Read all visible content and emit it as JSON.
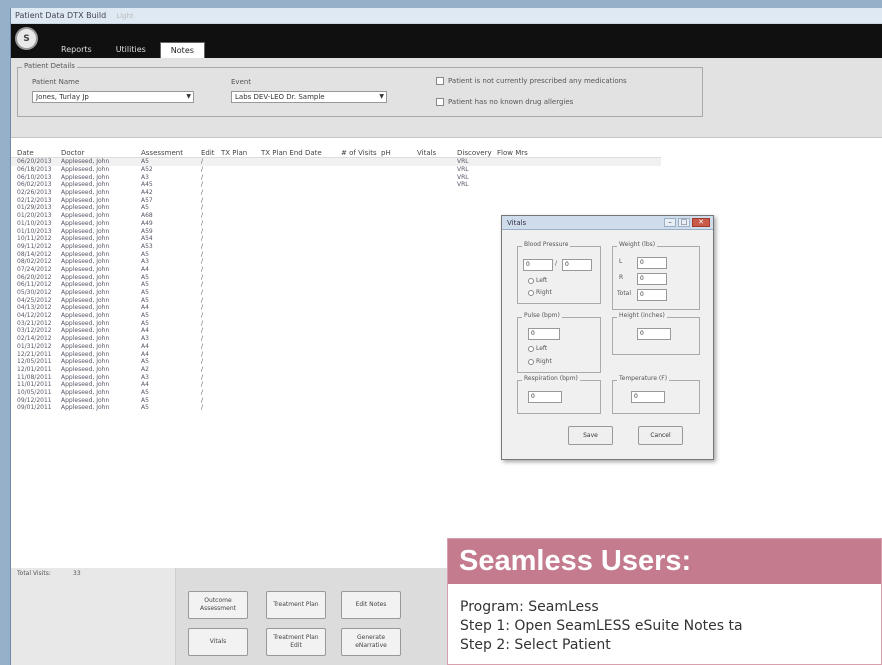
{
  "window": {
    "title": "Patient Data DTX Build",
    "title_tag": "Light"
  },
  "app": {
    "logo_text": "S",
    "tabs": [
      {
        "label": "Reports"
      },
      {
        "label": "Utilities"
      },
      {
        "label": "Notes"
      }
    ],
    "active_tab": 2
  },
  "filters": {
    "group_title": "Patient Details",
    "patient_name_label": "Patient Name",
    "patient_name_value": "Jones, Turlay Jp",
    "event_label": "Event",
    "event_value": "Labs DEV-LEO Dr. Sample",
    "check1_label": "Patient is not currently prescribed any medications",
    "check2_label": "Patient has no known drug allergies"
  },
  "grid": {
    "columns": [
      "Date",
      "Doctor",
      "Assessment",
      "Edit",
      "TX Plan",
      "TX Plan End Date",
      "# of Visits",
      "pH",
      "Vitals",
      "Discovery",
      "Flow Mrs"
    ],
    "rows": [
      {
        "date": "06/20/2013",
        "doctor": "Appleseed, John",
        "assess": "A5",
        "edit": "/",
        "vitals": "VRL"
      },
      {
        "date": "06/18/2013",
        "doctor": "Appleseed, John",
        "assess": "A52",
        "edit": "/",
        "vitals": "VRL"
      },
      {
        "date": "06/10/2013",
        "doctor": "Appleseed, John",
        "assess": "A3",
        "edit": "/",
        "vitals": "VRL"
      },
      {
        "date": "06/02/2013",
        "doctor": "Appleseed, John",
        "assess": "A45",
        "edit": "/",
        "vitals": "VRL"
      },
      {
        "date": "02/26/2013",
        "doctor": "Appleseed, John",
        "assess": "A42",
        "edit": "/",
        "vitals": ""
      },
      {
        "date": "02/12/2013",
        "doctor": "Appleseed, John",
        "assess": "A57",
        "edit": "/",
        "vitals": ""
      },
      {
        "date": "01/29/2013",
        "doctor": "Appleseed, John",
        "assess": "A5",
        "edit": "/",
        "vitals": ""
      },
      {
        "date": "01/20/2013",
        "doctor": "Appleseed, John",
        "assess": "A68",
        "edit": "/",
        "vitals": ""
      },
      {
        "date": "01/10/2013",
        "doctor": "Appleseed, John",
        "assess": "A49",
        "edit": "/",
        "vitals": ""
      },
      {
        "date": "01/10/2013",
        "doctor": "Appleseed, John",
        "assess": "A59",
        "edit": "/",
        "vitals": ""
      },
      {
        "date": "10/11/2012",
        "doctor": "Appleseed, John",
        "assess": "A54",
        "edit": "/",
        "vitals": ""
      },
      {
        "date": "09/11/2012",
        "doctor": "Appleseed, John",
        "assess": "A53",
        "edit": "/",
        "vitals": ""
      },
      {
        "date": "08/14/2012",
        "doctor": "Appleseed, John",
        "assess": "A5",
        "edit": "/",
        "vitals": ""
      },
      {
        "date": "08/02/2012",
        "doctor": "Appleseed, John",
        "assess": "A3",
        "edit": "/",
        "vitals": ""
      },
      {
        "date": "07/24/2012",
        "doctor": "Appleseed, John",
        "assess": "A4",
        "edit": "/",
        "vitals": ""
      },
      {
        "date": "06/20/2012",
        "doctor": "Appleseed, John",
        "assess": "A5",
        "edit": "/",
        "vitals": ""
      },
      {
        "date": "06/11/2012",
        "doctor": "Appleseed, John",
        "assess": "A5",
        "edit": "/",
        "vitals": ""
      },
      {
        "date": "05/30/2012",
        "doctor": "Appleseed, John",
        "assess": "A5",
        "edit": "/",
        "vitals": ""
      },
      {
        "date": "04/25/2012",
        "doctor": "Appleseed, John",
        "assess": "A5",
        "edit": "/",
        "vitals": ""
      },
      {
        "date": "04/13/2012",
        "doctor": "Appleseed, John",
        "assess": "A4",
        "edit": "/",
        "vitals": ""
      },
      {
        "date": "04/12/2012",
        "doctor": "Appleseed, John",
        "assess": "A5",
        "edit": "/",
        "vitals": ""
      },
      {
        "date": "03/21/2012",
        "doctor": "Appleseed, John",
        "assess": "A5",
        "edit": "/",
        "vitals": ""
      },
      {
        "date": "03/12/2012",
        "doctor": "Appleseed, John",
        "assess": "A4",
        "edit": "/",
        "vitals": ""
      },
      {
        "date": "02/14/2012",
        "doctor": "Appleseed, John",
        "assess": "A3",
        "edit": "/",
        "vitals": ""
      },
      {
        "date": "01/31/2012",
        "doctor": "Appleseed, John",
        "assess": "A4",
        "edit": "/",
        "vitals": ""
      },
      {
        "date": "12/21/2011",
        "doctor": "Appleseed, John",
        "assess": "A4",
        "edit": "/",
        "vitals": ""
      },
      {
        "date": "12/05/2011",
        "doctor": "Appleseed, John",
        "assess": "A5",
        "edit": "/",
        "vitals": ""
      },
      {
        "date": "12/01/2011",
        "doctor": "Appleseed, John",
        "assess": "A2",
        "edit": "/",
        "vitals": ""
      },
      {
        "date": "11/08/2011",
        "doctor": "Appleseed, John",
        "assess": "A3",
        "edit": "/",
        "vitals": ""
      },
      {
        "date": "11/01/2011",
        "doctor": "Appleseed, John",
        "assess": "A4",
        "edit": "/",
        "vitals": ""
      },
      {
        "date": "10/05/2011",
        "doctor": "Appleseed, John",
        "assess": "A5",
        "edit": "/",
        "vitals": ""
      },
      {
        "date": "09/12/2011",
        "doctor": "Appleseed, John",
        "assess": "A5",
        "edit": "/",
        "vitals": ""
      },
      {
        "date": "09/01/2011",
        "doctor": "Appleseed, John",
        "assess": "A5",
        "edit": "/",
        "vitals": ""
      }
    ]
  },
  "footer": {
    "total_label": "Total Visits:",
    "total_value": "33",
    "buttons": {
      "outcome": "Outcome Assessment",
      "treatment_plan": "Treatment Plan",
      "edit_notes": "Edit Notes",
      "vitals": "Vitals",
      "treatment_plan_edit": "Treatment Plan Edit",
      "generate_report": "Generate eNarrative"
    }
  },
  "vitals_dialog": {
    "title": "Vitals",
    "blood_pressure": {
      "title": "Blood Pressure",
      "systolic": "0",
      "diastolic": "0",
      "left": "Left",
      "right": "Right"
    },
    "weight": {
      "title": "Weight (lbs)",
      "l_label": "L",
      "l_value": "0",
      "r_label": "R",
      "r_value": "0",
      "total_label": "Total",
      "total_value": "0"
    },
    "pulse": {
      "title": "Pulse (bpm)",
      "value": "0",
      "left": "Left",
      "right": "Right"
    },
    "height": {
      "title": "Height (inches)",
      "value": "0"
    },
    "respiration": {
      "title": "Respiration (bpm)",
      "value": "0"
    },
    "temperature": {
      "title": "Temperature (F)",
      "value": "0"
    },
    "save_label": "Save",
    "cancel_label": "Cancel"
  },
  "card": {
    "heading": "Seamless Users:",
    "lines": [
      "Program: SeamLess",
      "Step 1: Open SeamLESS eSuite Notes ta",
      "Step 2: Select Patient"
    ]
  }
}
